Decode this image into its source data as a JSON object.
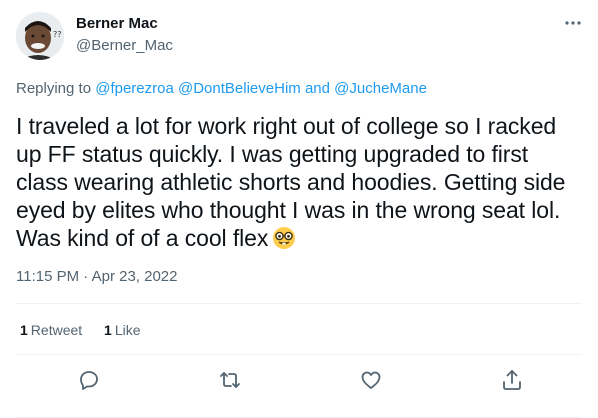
{
  "author": {
    "name": "Berner Mac",
    "handle": "@Berner_Mac"
  },
  "reply": {
    "prefix": "Replying to",
    "mention_1": "@fperezroa",
    "mention_2": "@DontBelieveHim",
    "conjunction": "and",
    "mention_3": "@JucheMane"
  },
  "tweet": {
    "text": "I traveled a lot for work right out of college so I racked up FF status quickly. I was getting upgraded to first class wearing athletic shorts and hoodies. Getting side eyed by elites who thought I was in the wrong seat lol. Was kind of of a cool flex",
    "emoji": "nerd-face-emoji",
    "timestamp": "11:15 PM · Apr 23, 2022"
  },
  "stats": {
    "retweets_count": "1",
    "retweets_label": "Retweet",
    "likes_count": "1",
    "likes_label": "Like"
  },
  "actions": [
    "reply-icon",
    "retweet-icon",
    "like-icon",
    "share-icon"
  ],
  "colors": {
    "link": "#1d9bf0",
    "secondary_text": "#536471",
    "primary_text": "#0f1419",
    "divider": "#eff3f4"
  }
}
